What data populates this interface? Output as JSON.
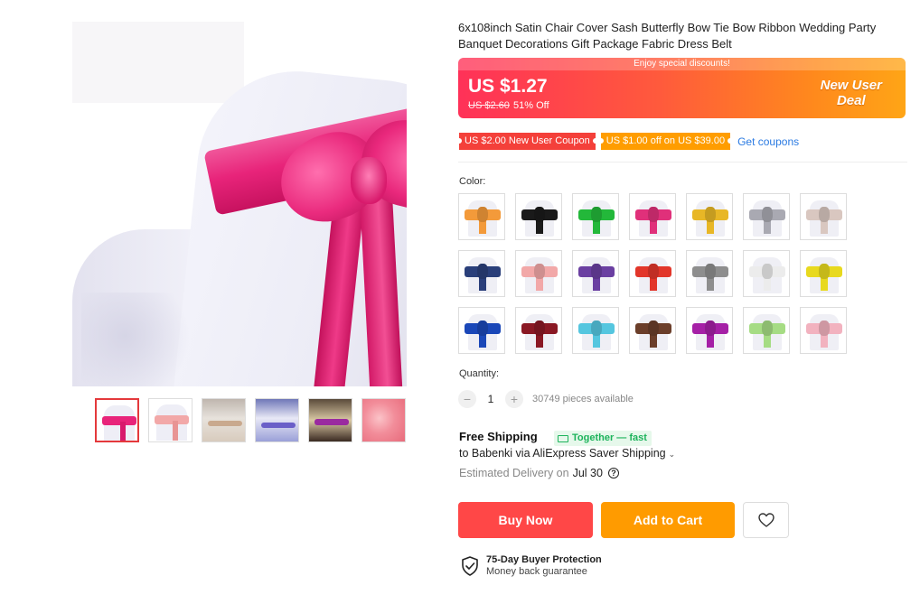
{
  "product": {
    "title": "6x108inch Satin Chair Cover Sash Butterfly Bow Tie Bow Ribbon Wedding Party Banquet Decorations Gift Package Fabric Dress Belt"
  },
  "price": {
    "banner": "Enjoy special discounts!",
    "current": "US $1.27",
    "original": "US $2.60",
    "discount": "51% Off",
    "deal_line1": "New User",
    "deal_line2": "Deal"
  },
  "coupons": {
    "items": [
      "US $2.00 New User Coupon",
      "US $1.00 off on US $39.00"
    ],
    "get_label": "Get coupons"
  },
  "color": {
    "label": "Color:",
    "options": [
      "#f39a3a",
      "#1a1a1a",
      "#23b83a",
      "#e0307a",
      "#e8b726",
      "#a9a9b2",
      "#d9c7c0",
      "#2a3f7a",
      "#f2a8a8",
      "#6a3fa1",
      "#e2362a",
      "#8e8e8e",
      "#ececec",
      "#e8d91e",
      "#1a47b8",
      "#8a1824",
      "#55c6df",
      "#6b3e2a",
      "#a520a6",
      "#a6dc84",
      "#f2b2bf"
    ]
  },
  "quantity": {
    "label": "Quantity:",
    "minus": "−",
    "plus": "+",
    "value": "1",
    "available": "30749 pieces available"
  },
  "shipping": {
    "title": "Free Shipping",
    "badge": "Together — fast",
    "to": "to Babenki via AliExpress Saver Shipping",
    "caret": "⌄",
    "estimated_label": "Estimated Delivery on",
    "date": "Jul 30",
    "help": "?"
  },
  "actions": {
    "buy": "Buy Now",
    "cart": "Add to Cart"
  },
  "protection": {
    "title": "75-Day Buyer Protection",
    "subtitle": "Money back guarantee"
  },
  "thumbnails": [
    {
      "sash": "#e8247a"
    },
    {
      "sash": "#f2a8a8"
    },
    {
      "sash": "#c9a98e"
    },
    {
      "sash": "#6a5fc8"
    },
    {
      "sash": "#9a2aa0"
    },
    {
      "sash": "#f08c9a"
    }
  ],
  "colors": {
    "accent_red": "#ff4747",
    "accent_orange": "#ff9b00",
    "link_blue": "#2a7ae2",
    "green": "#1cb35b"
  }
}
